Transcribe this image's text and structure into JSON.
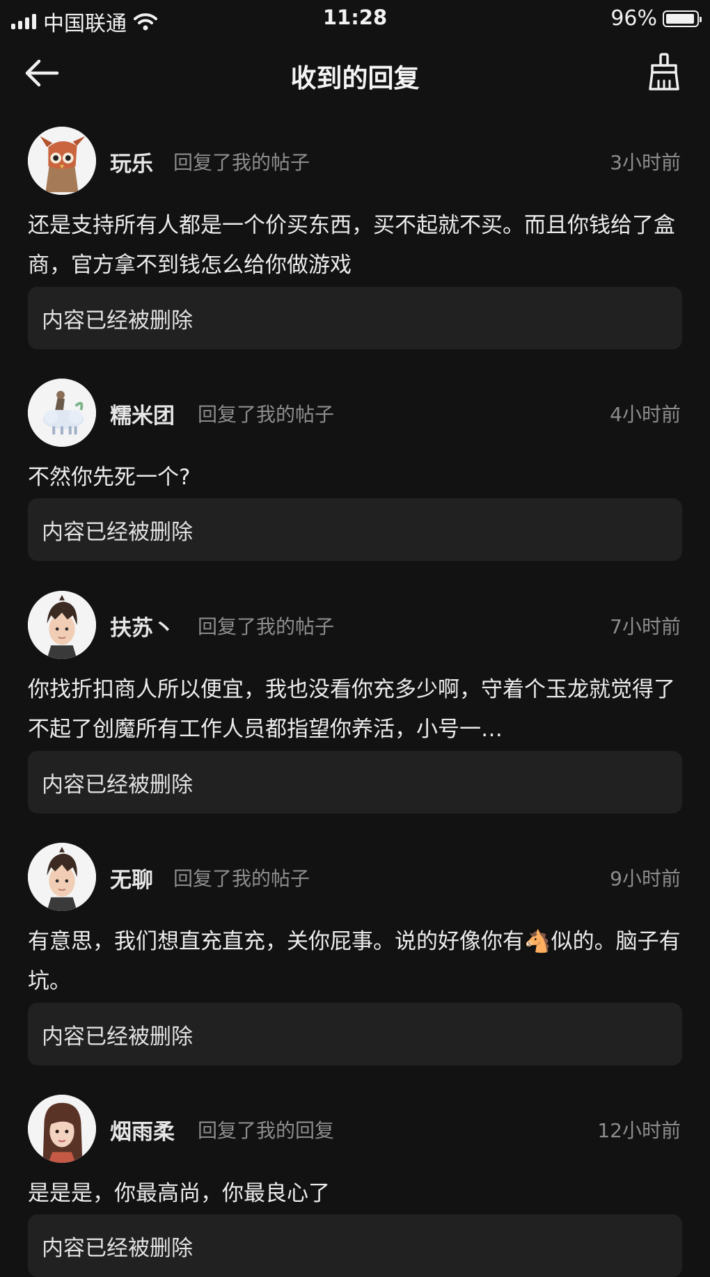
{
  "status_bar": {
    "carrier": "中国联通",
    "time": "11:28",
    "battery_percent": "96%",
    "battery_level": 0.96
  },
  "nav": {
    "title": "收到的回复",
    "back_icon": "arrow-left-icon",
    "clear_icon": "broom-icon"
  },
  "replies": [
    {
      "user": "玩乐",
      "action": "回复了我的帖子",
      "time": "3小时前",
      "text": "还是支持所有人都是一个价买东西，买不起就不买。而且你钱给了盒商，官方拿不到钱怎么给你做游戏",
      "quote": "内容已经被删除",
      "avatar_icon": "owl-avatar"
    },
    {
      "user": "糯米团",
      "action": "回复了我的帖子",
      "time": "4小时前",
      "text": "不然你先死一个?",
      "quote": "内容已经被删除",
      "avatar_icon": "cloud-creature-avatar"
    },
    {
      "user": "扶苏丶",
      "action": "回复了我的帖子",
      "time": "7小时前",
      "text": "你找折扣商人所以便宜，我也没看你充多少啊，守着个玉龙就觉得了不起了创魔所有工作人员都指望你养活，小号一…",
      "quote": "内容已经被删除",
      "avatar_icon": "boy-avatar"
    },
    {
      "user": "无聊",
      "action": "回复了我的帖子",
      "time": "9小时前",
      "text_before_emoji": "有意思，我们想直充直充，关你屁事。说的好像你有",
      "text_emoji": "🐴",
      "text_after_emoji": "似的。脑子有坑。",
      "quote": "内容已经被删除",
      "avatar_icon": "boy-avatar"
    },
    {
      "user": "烟雨柔",
      "action": "回复了我的回复",
      "time": "12小时前",
      "text": "是是是，你最高尚，你最良心了",
      "quote": "内容已经被删除",
      "avatar_icon": "girl-avatar"
    }
  ]
}
